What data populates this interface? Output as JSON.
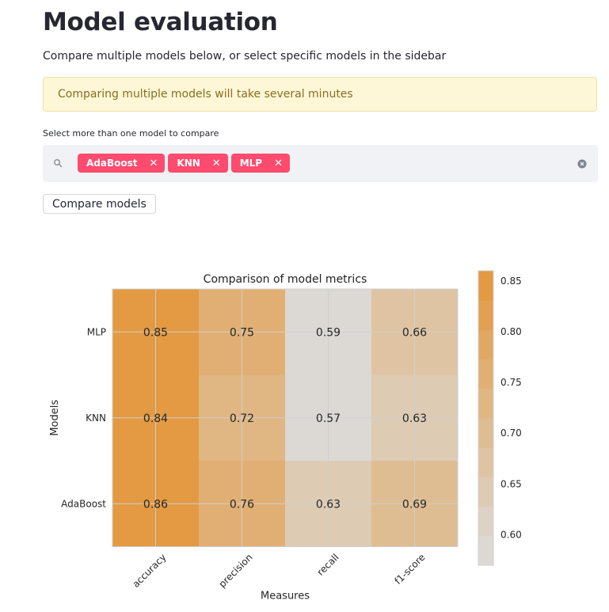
{
  "page": {
    "title": "Model evaluation",
    "subtitle": "Compare multiple models below, or select specific models in the sidebar"
  },
  "alert": {
    "message": "Comparing multiple models will take several minutes"
  },
  "model_select": {
    "label": "Select more than one model to compare",
    "selected": [
      "AdaBoost",
      "KNN",
      "MLP"
    ],
    "remove_glyph": "✕"
  },
  "compare_button": {
    "label": "Compare models"
  },
  "colors": {
    "chip_bg": "#ff4b6e",
    "alert_bg": "#fdf7d7",
    "alert_text": "#8a6d1e",
    "heat_high": "#e3963a",
    "heat_low": "#dcdcdc"
  },
  "chart_data": {
    "type": "heatmap",
    "title": "Comparison of model metrics",
    "xlabel": "Measures",
    "ylabel": "Models",
    "x_categories": [
      "accuracy",
      "precision",
      "recall",
      "f1-score"
    ],
    "y_categories": [
      "MLP",
      "KNN",
      "AdaBoost"
    ],
    "values": [
      [
        0.85,
        0.75,
        0.59,
        0.66
      ],
      [
        0.84,
        0.72,
        0.57,
        0.63
      ],
      [
        0.86,
        0.76,
        0.63,
        0.69
      ]
    ],
    "colorbar": {
      "ticks": [
        "0.85",
        "0.80",
        "0.75",
        "0.70",
        "0.65",
        "0.60"
      ],
      "tick_values": [
        0.85,
        0.8,
        0.75,
        0.7,
        0.65,
        0.6
      ],
      "range": [
        0.57,
        0.86
      ],
      "levels": 10
    },
    "grid": true
  }
}
